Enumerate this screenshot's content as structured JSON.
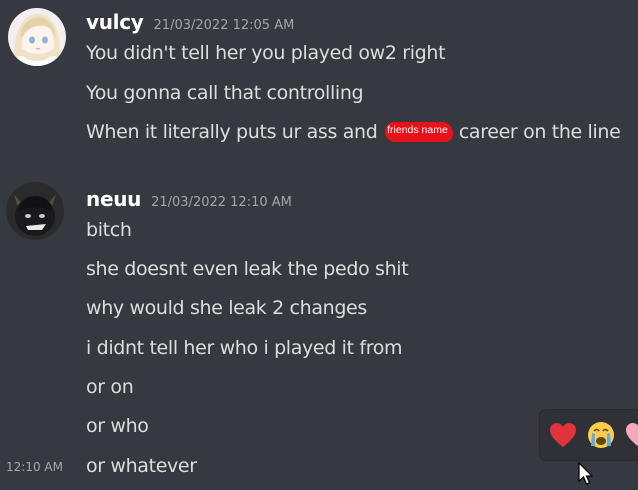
{
  "messages": [
    {
      "username": "vulcy",
      "timestamp": "21/03/2022 12:05 AM",
      "avatar_icon": "anime-girl-avatar",
      "lines": [
        {
          "text": "You didn't tell her you played ow2 right"
        },
        {
          "text": "You gonna call that controlling"
        },
        {
          "before": "When it literally puts ur ass and ",
          "redacted": "friends name",
          "after": " career on the line"
        }
      ]
    },
    {
      "username": "neuu",
      "timestamp": "21/03/2022 12:10 AM",
      "avatar_icon": "black-cat-avatar",
      "lines": [
        {
          "text": "bitch"
        },
        {
          "text": "she doesnt even leak the pedo shit"
        },
        {
          "text": "why would she leak 2 changes"
        },
        {
          "text": "i didnt tell her who i played it from"
        },
        {
          "text": "or on"
        },
        {
          "text": "or who"
        },
        {
          "text": "or whatever"
        }
      ],
      "hover_time": "12:10 AM"
    }
  ],
  "reactions": [
    {
      "icon": "red-heart-emoji",
      "color": "#e0333b"
    },
    {
      "icon": "crying-face-emoji",
      "color": "#ffcc4d"
    },
    {
      "icon": "pink-heart-emoji",
      "color": "#f4a8c0"
    }
  ],
  "colors": {
    "background": "#36393f",
    "text": "#dcddde",
    "username": "#ffffff",
    "timestamp": "#a3a6aa",
    "redaction": "#e8121a"
  }
}
